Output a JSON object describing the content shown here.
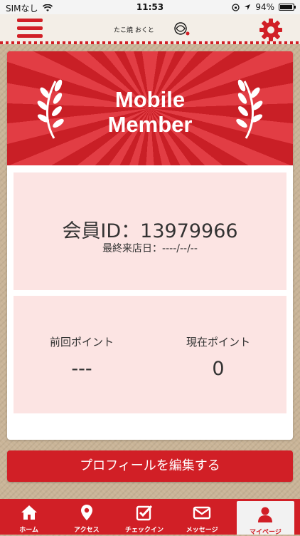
{
  "statusbar": {
    "carrier": "SIMなし",
    "time": "11:53",
    "battery": "94%",
    "battery_level": 0.94
  },
  "header": {
    "logo_text": "たこ焼 おくと"
  },
  "banner": {
    "title_line1": "Mobile",
    "title_line2": "Member"
  },
  "member": {
    "id_text": "会員ID：13979966",
    "last_visit": "最終来店日：----/--/--"
  },
  "points": {
    "previous_label": "前回ポイント",
    "previous_value": "---",
    "current_label": "現在ポイント",
    "current_value": "0"
  },
  "profile_button": "プロフィールを編集する",
  "tabs": [
    {
      "label": "ホーム",
      "icon": "home-icon"
    },
    {
      "label": "アクセス",
      "icon": "map-pin-icon"
    },
    {
      "label": "チェックイン",
      "icon": "checkin-icon"
    },
    {
      "label": "メッセージ",
      "icon": "mail-icon"
    },
    {
      "label": "マイページ",
      "icon": "user-icon",
      "active": true
    }
  ],
  "colors": {
    "brand_red": "#d11f26",
    "panel_pink": "#fce4e3",
    "background": "#c9b497"
  }
}
